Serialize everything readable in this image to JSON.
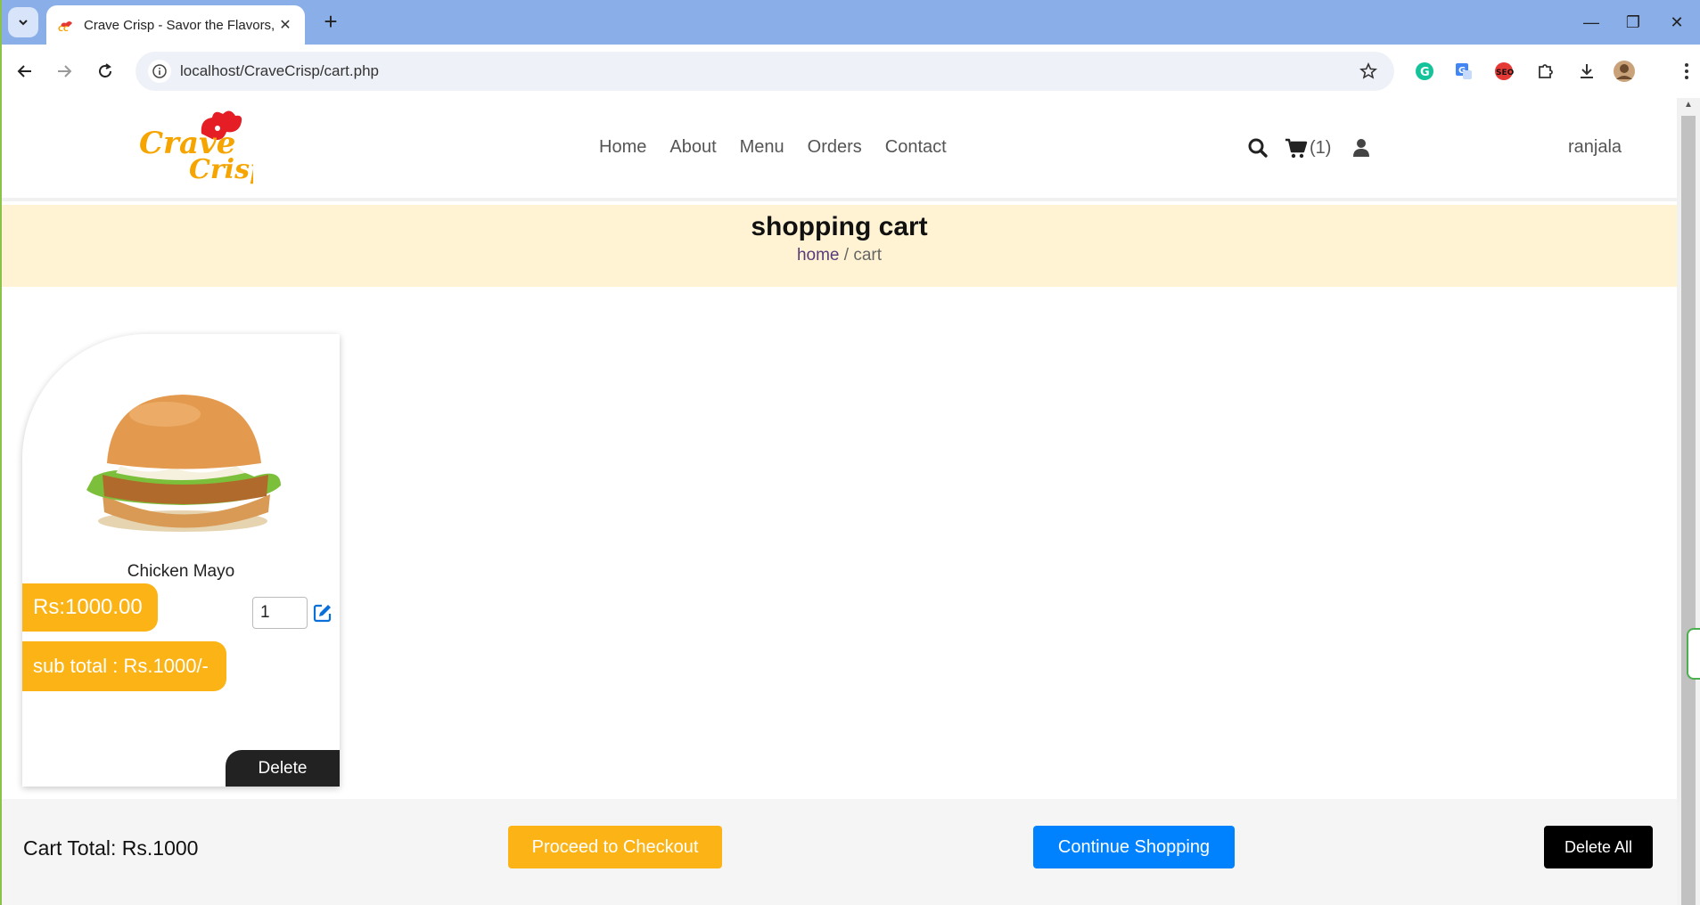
{
  "browser": {
    "tab_title": "Crave Crisp - Savor the Flavors,",
    "tab_close": "✕",
    "new_tab": "+",
    "url": "localhost/CraveCrisp/cart.php",
    "window_controls": {
      "minimize": "—",
      "restore": "❐",
      "close": "✕"
    }
  },
  "header": {
    "logo_text_1": "Crave",
    "logo_text_2": "Crisp",
    "nav": [
      "Home",
      "About",
      "Menu",
      "Orders",
      "Contact"
    ],
    "cart_count": "(1)",
    "username": "ranjala"
  },
  "banner": {
    "title": "shopping cart",
    "crumb_home": "home",
    "crumb_rest": " / cart"
  },
  "cart_items": [
    {
      "name": "Chicken Mayo",
      "price": "Rs:1000.00",
      "quantity": "1",
      "subtotal": "sub total : Rs.1000/-",
      "delete_label": "Delete"
    }
  ],
  "cart_bar": {
    "total": "Cart Total: Rs.1000",
    "checkout": "Proceed to Checkout",
    "continue": "Continue Shopping",
    "delete_all": "Delete All"
  },
  "colors": {
    "accent": "#fcb316",
    "primary_blue": "#0082ff",
    "banner_bg": "#fff3d3"
  }
}
